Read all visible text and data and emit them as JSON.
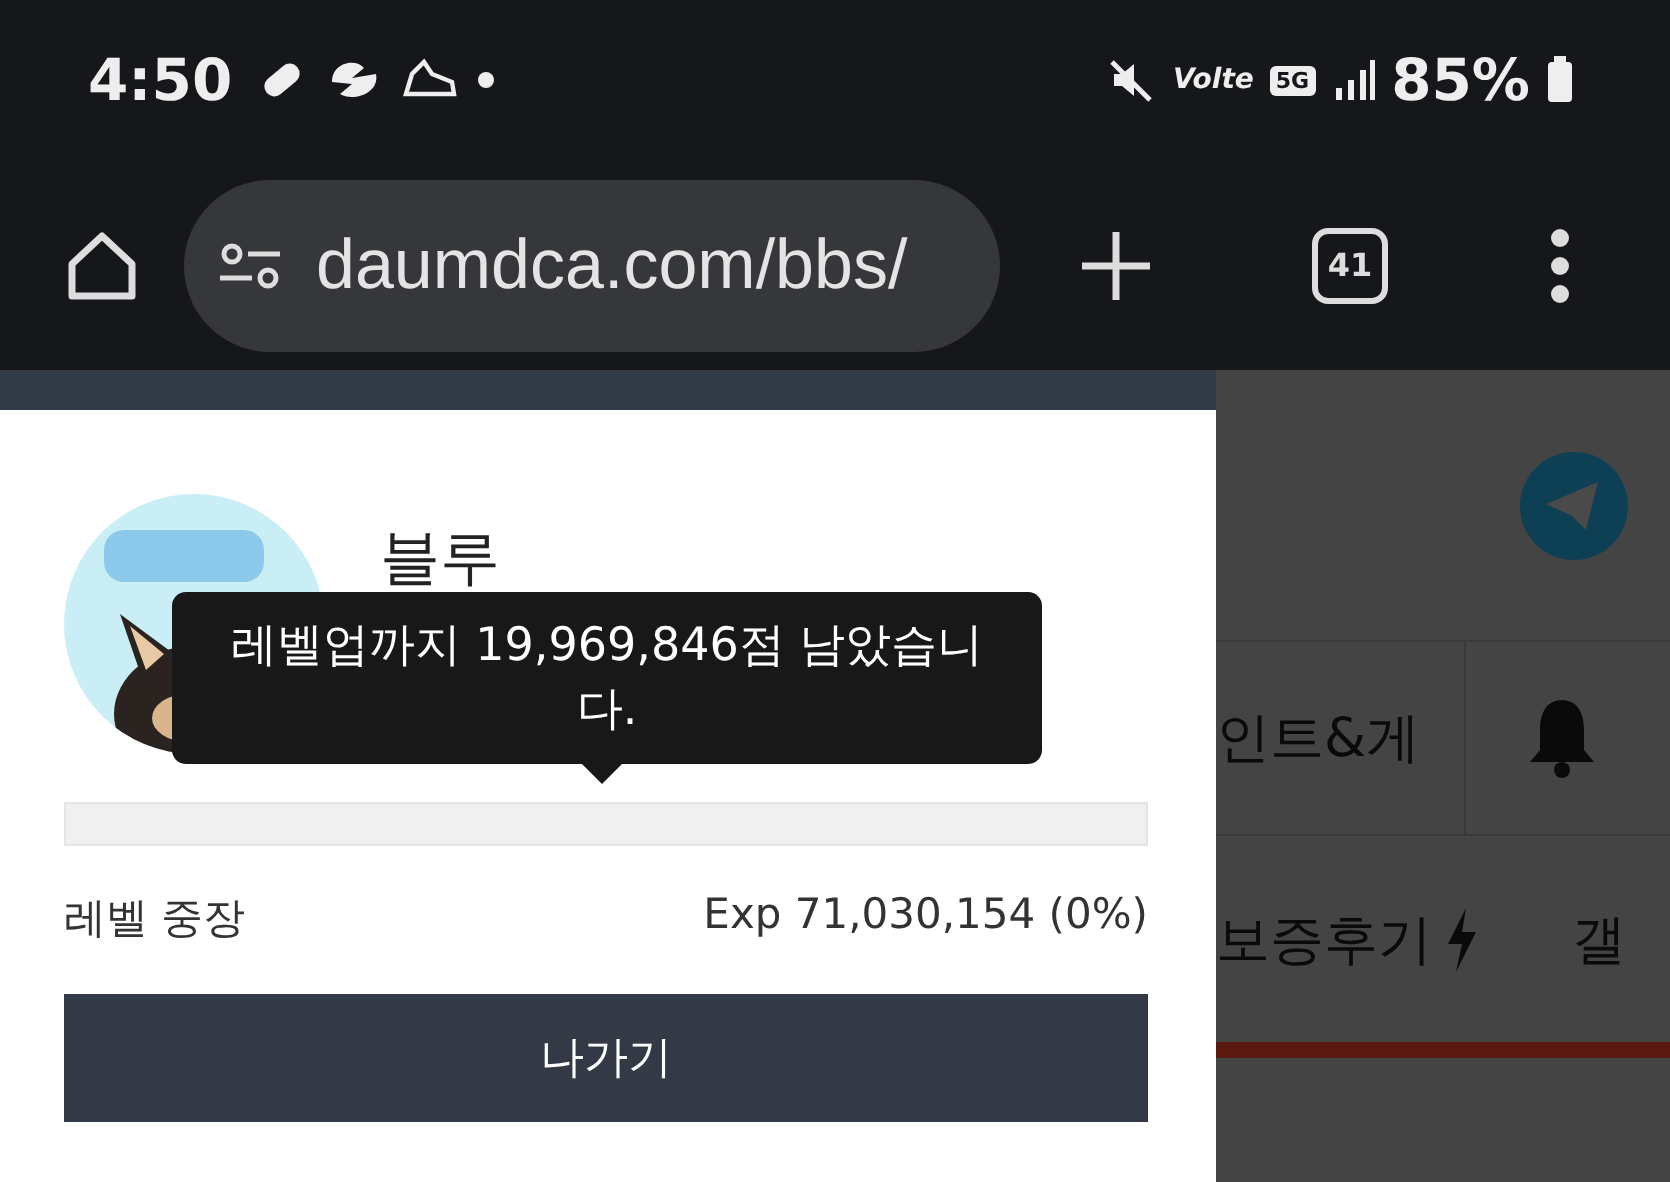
{
  "status_bar": {
    "time": "4:50",
    "network_label": "Volte",
    "network_badge": "5G",
    "battery": "85%"
  },
  "browser_toolbar": {
    "url": "daumdca.com/bbs/",
    "tab_count": "41"
  },
  "profile_panel": {
    "name": "블루",
    "tooltip": "레벨업까지 19,969,846점 남았습니다.",
    "progress": {
      "level": 0
    },
    "level_label": "레벨 중장",
    "exp": "Exp 71,030,154 (0%)",
    "exit_button": "나가기"
  },
  "background_page": {
    "menu_row": [
      "인트&게"
    ],
    "second_row": [
      "보증후기",
      "갤"
    ]
  }
}
